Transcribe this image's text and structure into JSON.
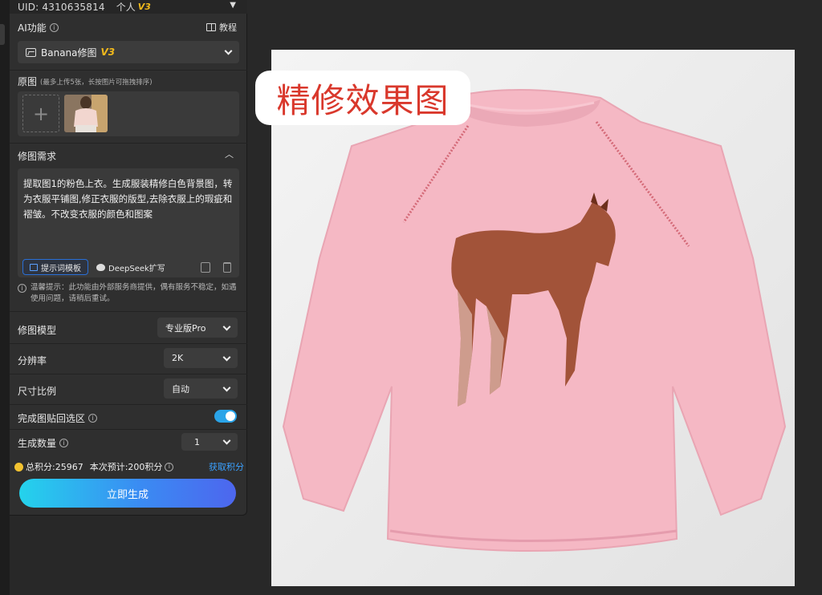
{
  "header": {
    "uid": "UID: 4310635814",
    "plan": "个人",
    "plan_badge": "V3"
  },
  "ai_function": {
    "label": "AI功能",
    "tutorial": "教程",
    "selected": "Banana修图",
    "selected_badge": "V3"
  },
  "original": {
    "label": "原图",
    "hint": "(最多上传5张，长按图片可拖拽排序)"
  },
  "requirement": {
    "label": "修图需求",
    "text": "提取图1的粉色上衣。生成服装精修白色背景图，转为衣服平铺图,修正衣服的版型,去除衣服上的瑕疵和褶皱。不改变衣服的颜色和图案",
    "template_button": "提示词模板",
    "deepseek_button": "DeepSeek扩写"
  },
  "notice": "温馨提示：此功能由外部服务商提供，偶有服务不稳定，如遇使用问题，请稍后重试。",
  "settings": {
    "model": {
      "label": "修图模型",
      "value": "专业版Pro"
    },
    "resolution": {
      "label": "分辨率",
      "value": "2K"
    },
    "aspect": {
      "label": "尺寸比例",
      "value": "自动"
    },
    "paste_back": {
      "label": "完成图贴回选区",
      "enabled": true
    },
    "count": {
      "label": "生成数量",
      "value": "1"
    }
  },
  "points": {
    "total": "总积分:25967",
    "estimate": "本次预计:200积分",
    "get": "获取积分"
  },
  "generate_button": "立即生成",
  "canvas": {
    "overlay_label": "精修效果图"
  },
  "colors": {
    "accent": "#2aa4e8",
    "badge": "#f1b91c",
    "link": "#3aa0ff",
    "overlay_text": "#d9382c",
    "shirt": "#f5b8c4",
    "horse": "#9a4a2c"
  },
  "icons": [
    "info-icon",
    "book-icon",
    "image-icon",
    "plus-icon",
    "template-icon",
    "deepseek-icon",
    "copy-icon",
    "trash-icon",
    "chevron-down-icon",
    "chevron-up-icon",
    "coin-icon"
  ]
}
